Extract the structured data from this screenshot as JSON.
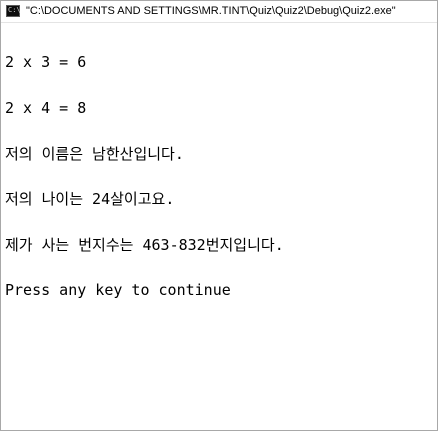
{
  "window": {
    "title": "\"C:\\DOCUMENTS AND SETTINGS\\MR.TINT\\Quiz\\Quiz2\\Debug\\Quiz2.exe\"",
    "icon": "console-app-icon",
    "icon_text": "C:\\"
  },
  "console": {
    "lines": [
      "2 x 3 = 6",
      "2 x 4 = 8",
      "저의 이름은 남한산입니다.",
      "저의 나이는 24살이고요.",
      "제가 사는 번지수는 463-832번지입니다.",
      "Press any key to continue"
    ]
  }
}
